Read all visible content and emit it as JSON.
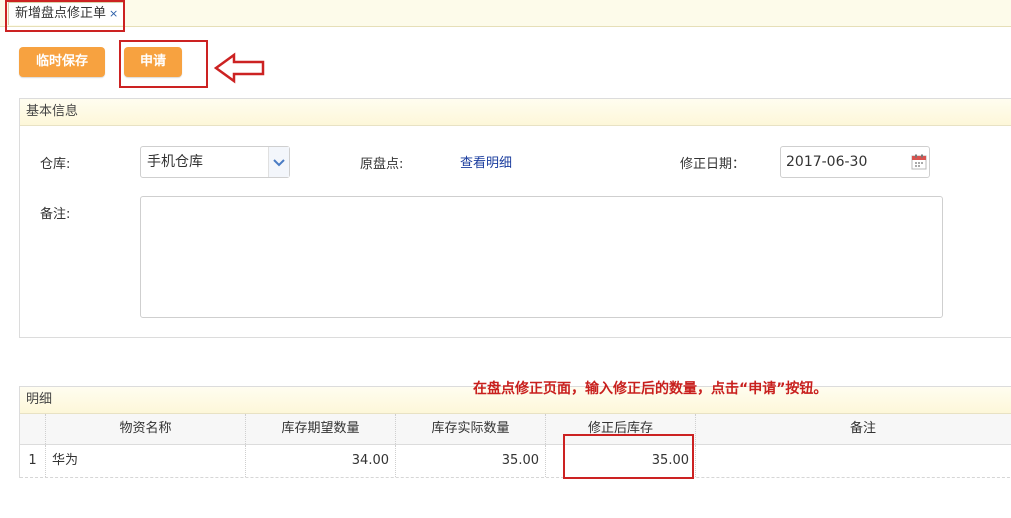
{
  "tabs": [
    {
      "label": "新增盘点修正单",
      "close": "×"
    }
  ],
  "toolbar": {
    "save_label": "临时保存",
    "apply_label": "申请"
  },
  "basic": {
    "header": "基本信息",
    "warehouse_label": "仓库:",
    "warehouse_value": "手机仓库",
    "original_label": "原盘点:",
    "original_link": "查看明细",
    "date_label": "修正日期：",
    "date_value": "2017-06-30",
    "remark_label": "备注:",
    "remark_value": ""
  },
  "detail": {
    "header": "明细",
    "columns": [
      "物资名称",
      "库存期望数量",
      "库存实际数量",
      "修正后库存",
      "备注"
    ],
    "rows": [
      {
        "index": "1",
        "name": "华为",
        "expected": "34.00",
        "actual": "35.00",
        "fixed": "35.00",
        "note": ""
      }
    ]
  },
  "annotation": "在盘点修正页面，输入修正后的数量，点击“申请”按钮。",
  "colors": {
    "accent": "#f7a240",
    "highlight": "#cc2222",
    "link": "#1a3c9e",
    "header_bg": "#fdf7d9"
  },
  "icons": {
    "select": "chevron-down-icon",
    "date": "calendar-icon",
    "pointer": "left-arrow-icon"
  }
}
